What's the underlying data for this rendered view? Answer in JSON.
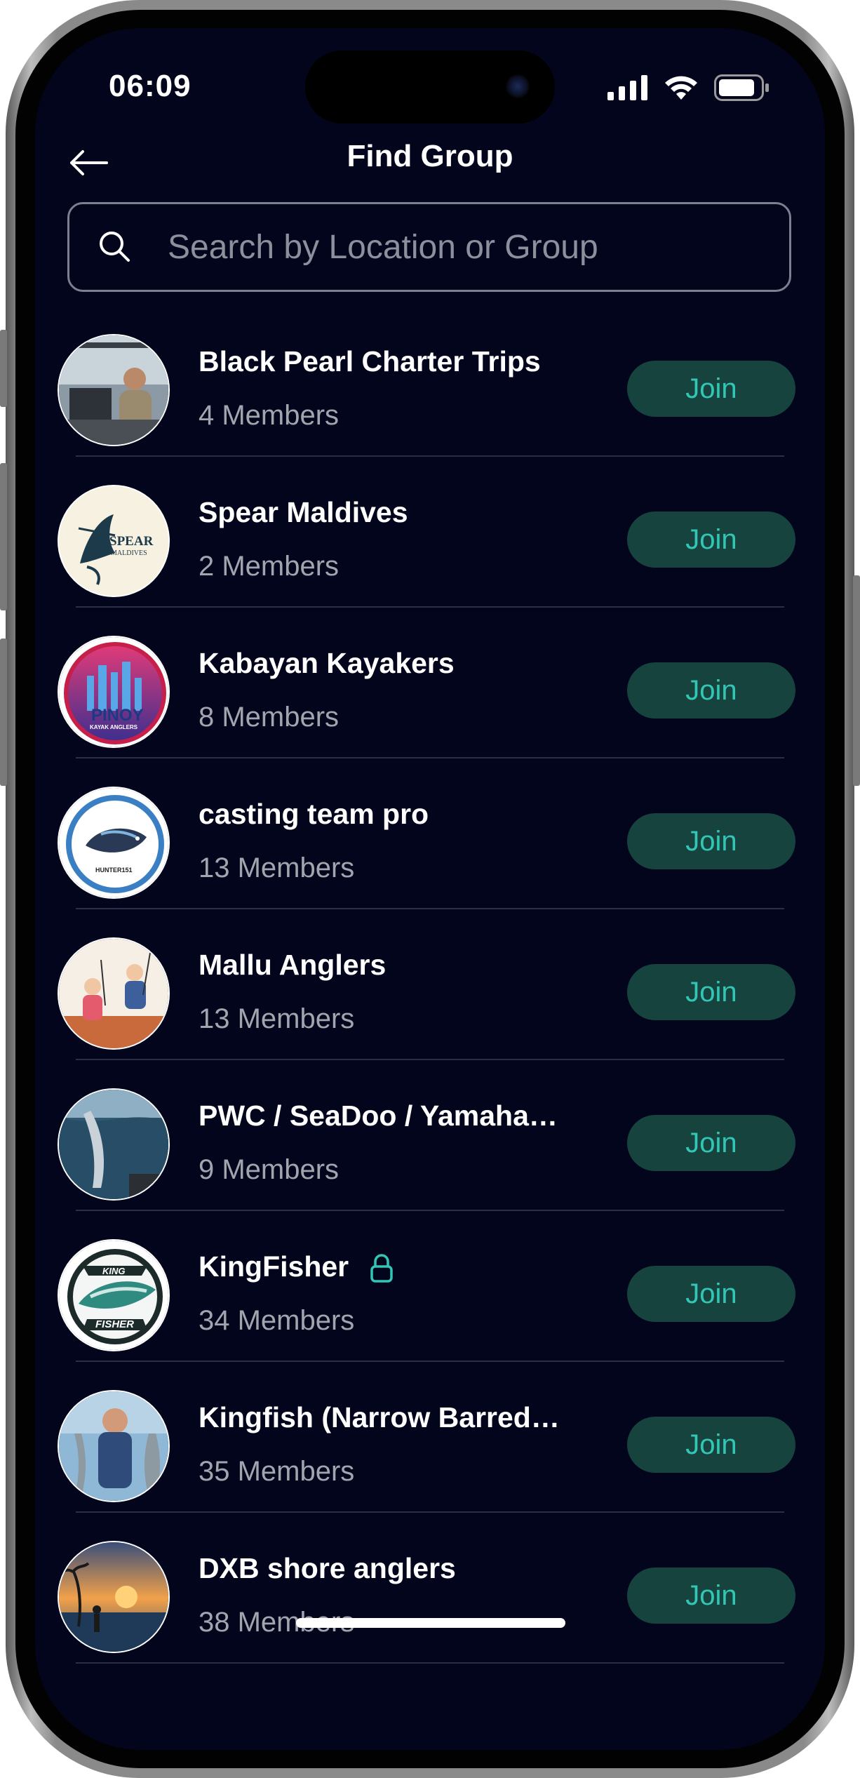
{
  "status": {
    "time": "06:09"
  },
  "header": {
    "title": "Find Group"
  },
  "search": {
    "placeholder": "Search by Location or Group"
  },
  "groups": [
    {
      "name": "Black Pearl Charter Trips",
      "members": "4 Members",
      "action": "Join",
      "private": false,
      "avatar_desc": "photo-man-on-boat"
    },
    {
      "name": "Spear Maldives",
      "members": "2 Members",
      "action": "Join",
      "private": false,
      "avatar_desc": "logo-spear-maldives",
      "avatar_text": [
        "SPEAR",
        "MALDIVES"
      ]
    },
    {
      "name": "Kabayan Kayakers",
      "members": "8 Members",
      "action": "Join",
      "private": false,
      "avatar_desc": "logo-pinoy-kayak-anglers",
      "avatar_text": [
        "PINOY",
        "KAYAK ANGLERS"
      ]
    },
    {
      "name": "casting team pro",
      "members": "13 Members",
      "action": "Join",
      "private": false,
      "avatar_desc": "logo-hunter-fish",
      "avatar_text": [
        "HUNTER151"
      ]
    },
    {
      "name": "Mallu Anglers",
      "members": "13 Members",
      "action": "Join",
      "private": false,
      "avatar_desc": "illustration-anglers"
    },
    {
      "name": "PWC / SeaDoo / Yamaha…",
      "members": "9 Members",
      "action": "Join",
      "private": false,
      "avatar_desc": "photo-fish-at-sea"
    },
    {
      "name": "KingFisher",
      "members": "34 Members",
      "action": "Join",
      "private": true,
      "avatar_desc": "logo-kingfisher",
      "avatar_text": [
        "KING",
        "FISHER"
      ]
    },
    {
      "name": "Kingfish (Narrow Barred…",
      "members": "35 Members",
      "action": "Join",
      "private": false,
      "avatar_desc": "photo-man-holding-fish"
    },
    {
      "name": "DXB shore anglers",
      "members": "38 Members",
      "action": "Join",
      "private": false,
      "avatar_desc": "photo-sunset-beach"
    }
  ],
  "colors": {
    "background": "#02051c",
    "join_bg": "#17433f",
    "join_text": "#32c7b5",
    "muted_text": "#a3a5ae"
  }
}
